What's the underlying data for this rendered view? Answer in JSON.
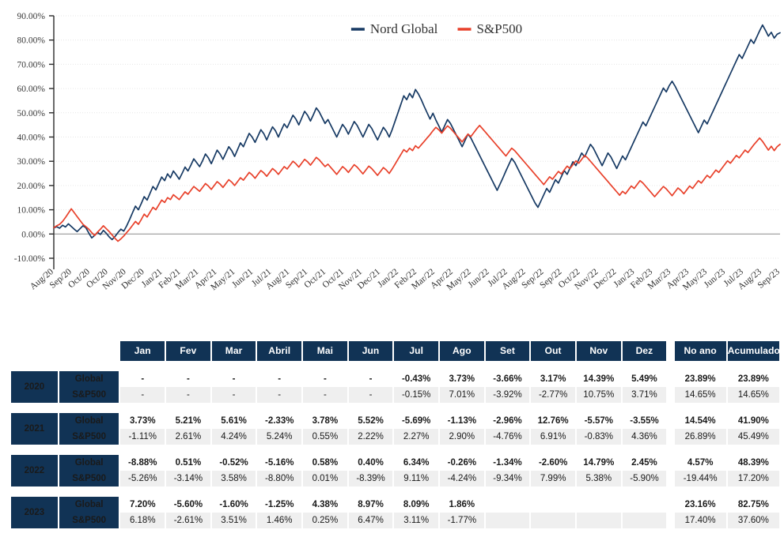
{
  "chart_data": {
    "type": "line",
    "title": "",
    "xlabel": "",
    "ylabel": "",
    "ylim": [
      -10,
      90
    ],
    "ytick_labels": [
      "90.00%",
      "80.00%",
      "70.00%",
      "60.00%",
      "50.00%",
      "40.00%",
      "30.00%",
      "20.00%",
      "10.00%",
      "0.00%",
      "-10.00%"
    ],
    "ytick_values": [
      90,
      80,
      70,
      60,
      50,
      40,
      30,
      20,
      10,
      0,
      -10
    ],
    "grid": true,
    "legend_position": "top-center",
    "legend": [
      "Nord Global",
      "S&P500"
    ],
    "colors": {
      "nord_global": "#163963",
      "sp500": "#E8402A"
    },
    "xtick_labels": [
      "Aug/20",
      "Sep/20",
      "Oct/20",
      "Oct/20",
      "Nov/20",
      "Dec/20",
      "Jan/21",
      "Feb/21",
      "Mar/21",
      "Apr/21",
      "May/21",
      "Jun/21",
      "Jul/21",
      "Aug/21",
      "Sep/21",
      "Oct/21",
      "Oct/21",
      "Nov/21",
      "Dec/21",
      "Jan/22",
      "Feb/22",
      "Mar/22",
      "Apr/22",
      "May/22",
      "Jun/22",
      "Jul/22",
      "Aug/22",
      "Sep/22",
      "Sep/22",
      "Oct/22",
      "Nov/22",
      "Dec/22",
      "Jan/23",
      "Feb/23",
      "Mar/23",
      "Apr/23",
      "May/23",
      "Jun/23",
      "Jul/23",
      "Aug/23",
      "Sep/23"
    ],
    "series": [
      {
        "name": "Nord Global",
        "color": "#163963",
        "values": [
          2.5,
          3.0,
          2.4,
          3.6,
          2.9,
          4.2,
          3.1,
          2.0,
          1.0,
          2.2,
          3.4,
          2.6,
          0.4,
          -1.6,
          -0.6,
          0.7,
          -0.2,
          1.5,
          0.3,
          -1.2,
          -2.3,
          -1.0,
          0.6,
          2.0,
          1.2,
          3.4,
          6.0,
          8.8,
          11.5,
          10.0,
          12.6,
          15.4,
          14.0,
          16.8,
          19.6,
          18.2,
          20.9,
          23.5,
          22.0,
          24.8,
          23.2,
          26.0,
          24.4,
          22.6,
          25.0,
          27.6,
          26.0,
          28.4,
          31.0,
          29.4,
          27.8,
          30.2,
          33.0,
          31.4,
          29.0,
          31.8,
          34.6,
          33.0,
          30.8,
          33.4,
          36.0,
          34.4,
          32.0,
          34.8,
          37.6,
          36.0,
          38.8,
          41.5,
          40.0,
          37.8,
          40.4,
          43.0,
          41.4,
          38.8,
          41.6,
          44.2,
          42.6,
          40.0,
          42.8,
          45.4,
          43.8,
          46.4,
          49.0,
          47.4,
          45.0,
          47.8,
          50.6,
          49.0,
          46.6,
          49.2,
          52.0,
          50.4,
          48.0,
          45.6,
          47.2,
          44.8,
          42.4,
          40.0,
          42.6,
          45.2,
          43.6,
          41.2,
          43.8,
          46.4,
          44.8,
          42.4,
          40.0,
          42.6,
          45.2,
          43.6,
          41.2,
          38.8,
          41.4,
          44.0,
          42.4,
          40.0,
          43.0,
          46.5,
          50.0,
          53.5,
          57.0,
          55.4,
          58.0,
          56.2,
          59.6,
          57.8,
          55.4,
          52.6,
          50.0,
          47.4,
          49.8,
          47.0,
          44.6,
          42.0,
          44.6,
          47.2,
          45.6,
          43.2,
          40.8,
          38.4,
          36.0,
          38.6,
          41.2,
          39.6,
          37.2,
          34.8,
          32.4,
          30.0,
          27.6,
          25.2,
          22.8,
          20.4,
          18.0,
          20.6,
          23.2,
          26.0,
          28.6,
          31.2,
          29.6,
          27.2,
          24.8,
          22.4,
          20.0,
          17.6,
          15.2,
          12.8,
          11.0,
          13.6,
          16.2,
          18.8,
          17.2,
          19.8,
          22.4,
          21.0,
          23.6,
          26.2,
          24.6,
          27.2,
          29.8,
          28.2,
          30.8,
          33.4,
          31.8,
          34.4,
          37.0,
          35.4,
          33.0,
          30.6,
          28.2,
          30.8,
          33.4,
          31.8,
          29.4,
          27.0,
          29.6,
          32.2,
          30.6,
          33.2,
          35.8,
          38.4,
          41.0,
          43.6,
          46.2,
          44.6,
          47.2,
          49.8,
          52.4,
          55.0,
          57.6,
          60.2,
          58.6,
          61.2,
          63.0,
          61.0,
          58.6,
          56.2,
          53.8,
          51.4,
          49.0,
          46.6,
          44.2,
          41.8,
          44.4,
          47.0,
          45.4,
          48.0,
          50.6,
          53.2,
          55.8,
          58.4,
          61.0,
          63.6,
          66.2,
          68.8,
          71.4,
          74.0,
          72.4,
          75.0,
          77.6,
          80.2,
          78.6,
          81.2,
          83.8,
          86.2,
          84.0,
          81.6,
          83.2,
          80.8,
          82.4,
          83.0
        ]
      },
      {
        "name": "S&P500",
        "color": "#E8402A",
        "values": [
          2.6,
          3.4,
          4.0,
          5.2,
          6.8,
          8.6,
          10.4,
          8.8,
          7.2,
          5.6,
          4.0,
          3.0,
          2.0,
          0.6,
          -0.6,
          0.8,
          2.0,
          3.4,
          2.2,
          1.0,
          -0.4,
          -1.8,
          -3.0,
          -2.0,
          -0.8,
          0.6,
          2.0,
          3.6,
          5.2,
          4.0,
          6.0,
          8.2,
          7.0,
          9.0,
          11.0,
          10.0,
          12.0,
          14.0,
          13.0,
          15.0,
          14.2,
          16.2,
          15.2,
          14.2,
          15.8,
          17.4,
          16.4,
          18.0,
          19.6,
          18.6,
          17.6,
          19.2,
          20.8,
          19.8,
          18.4,
          20.0,
          21.6,
          20.6,
          19.2,
          20.8,
          22.4,
          21.4,
          20.0,
          21.6,
          23.2,
          22.2,
          23.8,
          25.4,
          24.4,
          23.0,
          24.6,
          26.2,
          25.2,
          23.8,
          25.4,
          27.0,
          26.0,
          24.6,
          26.2,
          27.8,
          26.8,
          28.4,
          30.0,
          29.0,
          27.6,
          29.2,
          30.8,
          29.8,
          28.4,
          30.0,
          31.6,
          30.6,
          29.2,
          27.8,
          28.8,
          27.4,
          26.0,
          24.6,
          26.2,
          27.8,
          26.8,
          25.4,
          27.0,
          28.6,
          27.6,
          26.2,
          24.8,
          26.4,
          28.0,
          27.0,
          25.6,
          24.2,
          25.8,
          27.4,
          26.4,
          25.0,
          26.8,
          28.8,
          30.8,
          32.8,
          34.8,
          33.8,
          35.4,
          34.4,
          36.4,
          35.4,
          36.8,
          38.2,
          39.6,
          41.0,
          42.6,
          44.0,
          43.0,
          41.6,
          43.2,
          44.6,
          43.6,
          42.2,
          40.8,
          39.4,
          38.0,
          39.6,
          41.2,
          40.2,
          41.8,
          43.4,
          44.8,
          43.4,
          42.0,
          40.6,
          39.2,
          37.8,
          36.4,
          35.0,
          33.6,
          32.2,
          33.8,
          35.4,
          34.4,
          33.0,
          31.6,
          30.2,
          28.8,
          27.4,
          26.0,
          24.6,
          23.2,
          21.8,
          20.4,
          22.0,
          23.6,
          22.6,
          24.2,
          25.8,
          24.8,
          26.4,
          28.0,
          27.0,
          28.6,
          30.2,
          29.2,
          30.8,
          32.4,
          31.4,
          30.0,
          28.6,
          27.2,
          25.8,
          24.4,
          23.0,
          21.6,
          20.2,
          18.8,
          17.4,
          16.0,
          17.6,
          16.6,
          18.2,
          19.8,
          18.8,
          20.4,
          22.0,
          21.0,
          19.6,
          18.2,
          16.8,
          15.4,
          16.8,
          18.2,
          19.6,
          18.6,
          17.2,
          15.8,
          17.4,
          19.0,
          18.0,
          16.6,
          18.2,
          19.8,
          18.8,
          20.4,
          22.0,
          21.0,
          22.6,
          24.2,
          23.2,
          24.8,
          26.4,
          25.4,
          27.0,
          28.6,
          30.2,
          29.2,
          30.8,
          32.4,
          31.4,
          33.0,
          34.6,
          33.6,
          35.2,
          36.8,
          38.2,
          39.6,
          38.2,
          36.4,
          34.6,
          36.2,
          34.4,
          36.0,
          37.0
        ]
      }
    ]
  },
  "table": {
    "columns": [
      "Jan",
      "Fev",
      "Mar",
      "Abril",
      "Mai",
      "Jun",
      "Jul",
      "Ago",
      "Set",
      "Out",
      "Nov",
      "Dez"
    ],
    "total_columns": [
      "No ano",
      "Acumulado"
    ],
    "blocks": [
      {
        "year": "2020",
        "rows": [
          {
            "label": "Global",
            "months": [
              "-",
              "-",
              "-",
              "-",
              "-",
              "-",
              "-0.43%",
              "3.73%",
              "-3.66%",
              "3.17%",
              "14.39%",
              "5.49%"
            ],
            "no_ano": "23.89%",
            "acumulado": "23.89%"
          },
          {
            "label": "S&P500",
            "months": [
              "-",
              "-",
              "-",
              "-",
              "-",
              "-",
              "-0.15%",
              "7.01%",
              "-3.92%",
              "-2.77%",
              "10.75%",
              "3.71%"
            ],
            "no_ano": "14.65%",
            "acumulado": "14.65%"
          }
        ]
      },
      {
        "year": "2021",
        "rows": [
          {
            "label": "Global",
            "months": [
              "3.73%",
              "5.21%",
              "5.61%",
              "-2.33%",
              "3.78%",
              "5.52%",
              "-5.69%",
              "-1.13%",
              "-2.96%",
              "12.76%",
              "-5.57%",
              "-3.55%"
            ],
            "no_ano": "14.54%",
            "acumulado": "41.90%"
          },
          {
            "label": "S&P500",
            "months": [
              "-1.11%",
              "2.61%",
              "4.24%",
              "5.24%",
              "0.55%",
              "2.22%",
              "2.27%",
              "2.90%",
              "-4.76%",
              "6.91%",
              "-0.83%",
              "4.36%"
            ],
            "no_ano": "26.89%",
            "acumulado": "45.49%"
          }
        ]
      },
      {
        "year": "2022",
        "rows": [
          {
            "label": "Global",
            "months": [
              "-8.88%",
              "0.51%",
              "-0.52%",
              "-5.16%",
              "0.58%",
              "0.40%",
              "6.34%",
              "-0.26%",
              "-1.34%",
              "-2.60%",
              "14.79%",
              "2.45%"
            ],
            "no_ano": "4.57%",
            "acumulado": "48.39%"
          },
          {
            "label": "S&P500",
            "months": [
              "-5.26%",
              "-3.14%",
              "3.58%",
              "-8.80%",
              "0.01%",
              "-8.39%",
              "9.11%",
              "-4.24%",
              "-9.34%",
              "7.99%",
              "5.38%",
              "-5.90%"
            ],
            "no_ano": "-19.44%",
            "acumulado": "17.20%"
          }
        ]
      },
      {
        "year": "2023",
        "rows": [
          {
            "label": "Global",
            "months": [
              "7.20%",
              "-5.60%",
              "-1.60%",
              "-1.25%",
              "4.38%",
              "8.97%",
              "8.09%",
              "1.86%",
              "",
              "",
              "",
              ""
            ],
            "no_ano": "23.16%",
            "acumulado": "82.75%"
          },
          {
            "label": "S&P500",
            "months": [
              "6.18%",
              "-2.61%",
              "3.51%",
              "1.46%",
              "0.25%",
              "6.47%",
              "3.11%",
              "-1.77%",
              "",
              "",
              "",
              ""
            ],
            "no_ano": "17.40%",
            "acumulado": "37.60%"
          }
        ]
      }
    ]
  }
}
